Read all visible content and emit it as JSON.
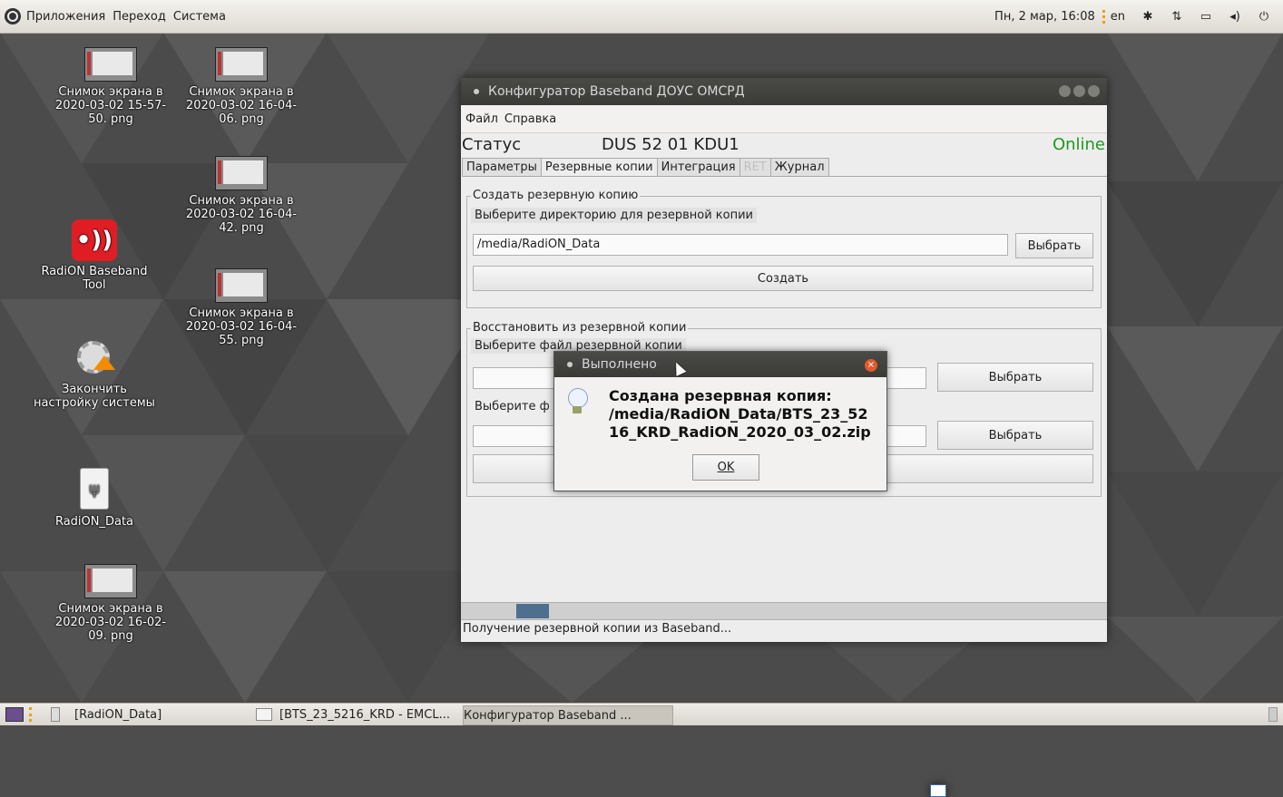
{
  "top_panel": {
    "menus": [
      "Приложения",
      "Переход",
      "Система"
    ],
    "clock": "Пн, 2 мар, 16:08",
    "keyboard_layout": "en"
  },
  "desktop_icons": [
    {
      "label": "Снимок экрана в 2020-03-02 15-57-50. png"
    },
    {
      "label": "Снимок экрана в 2020-03-02 16-04-06. png"
    },
    {
      "label": "Снимок экрана в 2020-03-02 16-04-42. png"
    },
    {
      "label": "RadiON Baseband Tool"
    },
    {
      "label": "Снимок экрана в 2020-03-02 16-04-55. png"
    },
    {
      "label": "Закончить настройку системы"
    },
    {
      "label": "RadiON_Data"
    },
    {
      "label": "Снимок экрана в 2020-03-02 16-02-09. png"
    }
  ],
  "main_window": {
    "title": "Конфигуратор Baseband ДОУС ОМСРД",
    "menu": [
      "Файл",
      "Справка"
    ],
    "status_label": "Статус",
    "device": "DUS 52 01 KDU1",
    "online": "Online",
    "tabs": [
      {
        "label": "Параметры",
        "state": "normal"
      },
      {
        "label": "Резервные копии",
        "state": "active"
      },
      {
        "label": "Интеграция",
        "state": "normal"
      },
      {
        "label": "RET",
        "state": "disabled"
      },
      {
        "label": "Журнал",
        "state": "normal"
      }
    ],
    "backup_group": {
      "title": "Создать резервную копию",
      "dir_label": "Выберите директорию для резервной копии",
      "dir_value": "/media/RadiON_Data",
      "choose_label": "Выбрать",
      "create_label": "Создать"
    },
    "restore_group": {
      "title": "Восстановить из резервной копии",
      "file_label_1": "Выберите файл резервной копии",
      "file_label_2": "Выберите ф",
      "choose_label_1": "Выбрать",
      "choose_label_2": "Выбрать"
    },
    "progress_fraction": 0.05,
    "status_text": "Получение резервной копии из Baseband..."
  },
  "dialog": {
    "title": "Выполнено",
    "message_lines": [
      "Создана резервная копия:",
      "/media/RadiON_Data/BTS_23_52",
      "16_KRD_RadiON_2020_03_02.zip"
    ],
    "ok_label": "OK"
  },
  "taskbar": {
    "tasks": [
      "[RadiON_Data]",
      "[BTS_23_5216_KRD - EMCL...",
      "Конфигуратор Baseband ..."
    ]
  },
  "colors": {
    "online": "#1e9a1e",
    "progress_fill": "#4f6f8f",
    "app_icon": "#e01d25"
  }
}
